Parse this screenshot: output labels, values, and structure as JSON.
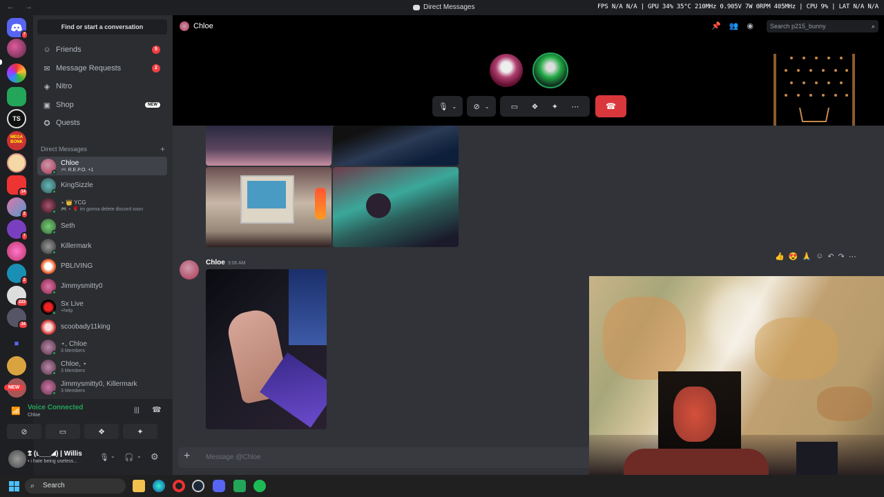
{
  "titlebar": {
    "nav": "← →",
    "title": "Direct Messages",
    "stats": "FPS N/A N/A | GPU 34% 35°C 210MHz 0.905V 7W 0RPM 405MHz | CPU 9% | LAT N/A N/A"
  },
  "server_badges": [
    "7",
    "14",
    "2",
    "2",
    "7",
    "223",
    "34",
    "NEW"
  ],
  "sidebar": {
    "find_button": "Find or start a conversation",
    "nav": [
      {
        "label": "Friends",
        "badge": "5"
      },
      {
        "label": "Message Requests",
        "badge": "2"
      },
      {
        "label": "Nitro",
        "badge": ""
      },
      {
        "label": "Shop",
        "badge": "NEW"
      },
      {
        "label": "Quests",
        "badge": ""
      }
    ],
    "dm_header": "Direct Messages",
    "dms": [
      {
        "name": "Chloe",
        "sub": "🎮 R.E.P.O. +1"
      },
      {
        "name": "KingSizzle",
        "sub": ""
      },
      {
        "name": "⋆ 👑 YCG",
        "sub": "🎮 ⋆ 🌹 im gonna delete discord soon"
      },
      {
        "name": "Seth",
        "sub": ""
      },
      {
        "name": "Killermark",
        "sub": ""
      },
      {
        "name": "PBLIVING",
        "sub": ""
      },
      {
        "name": "Jimmysmitty0",
        "sub": ""
      },
      {
        "name": "Sx Live",
        "sub": "+help"
      },
      {
        "name": "scoobady11king",
        "sub": ""
      },
      {
        "name": "⋆, Chloe",
        "sub": "3 Members"
      },
      {
        "name": "Chloe, ⋆",
        "sub": "3 Members"
      },
      {
        "name": "Jimmysmitty0, Killermark",
        "sub": "3 Members"
      }
    ]
  },
  "voice": {
    "status": "Voice Connected",
    "channel": "Chloe"
  },
  "user": {
    "name": "𝕿 (ʟ___◢) | Willis",
    "status": "• i hate being useless..."
  },
  "call": {
    "header_name": "Chloe",
    "search_placeholder": "Search p215_bunny"
  },
  "message": {
    "author": "Chloe",
    "time": "3:06 AM"
  },
  "input": {
    "placeholder": "Message @Chloe"
  },
  "taskbar": {
    "search": "Search"
  },
  "colors": {
    "accent": "#5865f2",
    "online": "#23a55a",
    "danger": "#da373c"
  }
}
